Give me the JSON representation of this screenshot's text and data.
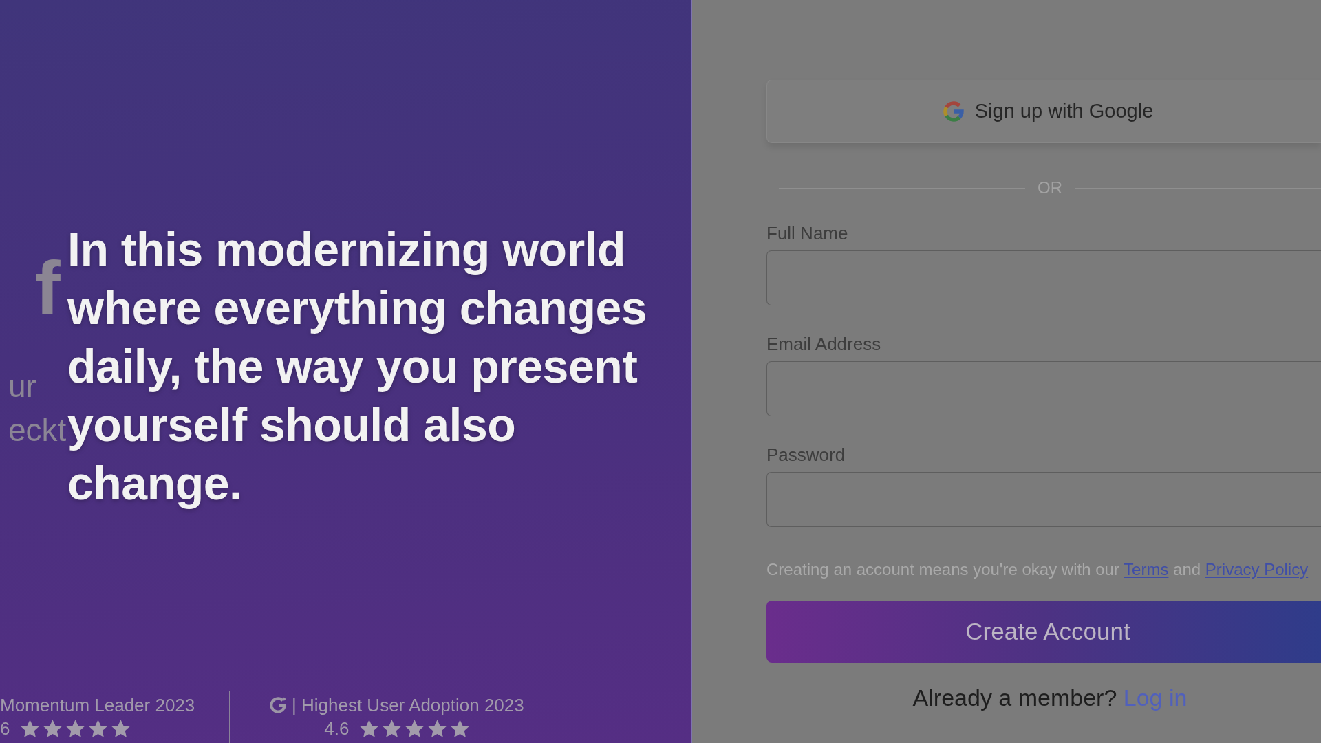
{
  "background_page": {
    "heading": "f",
    "subtitle_lines": [
      "ur",
      "eckt"
    ],
    "awards": [
      {
        "kind": "text",
        "title": "Momentum Leader 2023",
        "rating": "6",
        "stars": 5
      },
      {
        "kind": "logo",
        "title": "| Highest User Adoption 2023",
        "rating": "4.6",
        "stars": 5
      }
    ]
  },
  "caption": "In this modernizing world where everything changes daily, the way you present yourself should also change.",
  "signup_form": {
    "google_button": "Sign up with Google",
    "divider": "OR",
    "fields": [
      {
        "label": "Full Name"
      },
      {
        "label": "Email Address"
      },
      {
        "label": "Password"
      }
    ],
    "terms": [
      {
        "kind": "text",
        "text": "Creating an account means you're okay with our"
      },
      {
        "kind": "link",
        "text": "Terms"
      },
      {
        "kind": "text",
        "text": "and"
      },
      {
        "kind": "link",
        "text": "Privacy Policy"
      }
    ],
    "submit_button": "Create Account",
    "login_prompt": {
      "text": "Already a member?",
      "link": "Log in"
    }
  }
}
